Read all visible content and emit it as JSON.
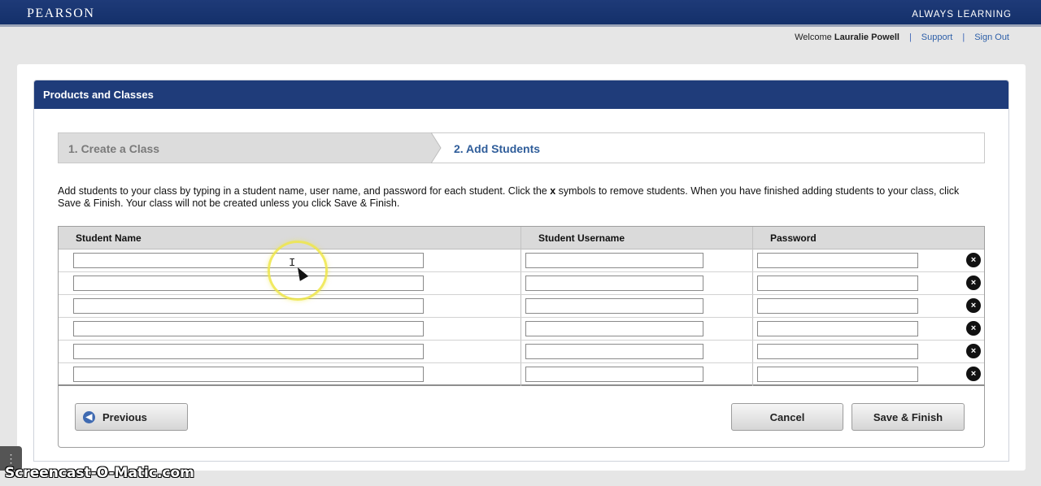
{
  "header": {
    "brand": "PEARSON",
    "tagline": "ALWAYS LEARNING"
  },
  "user": {
    "welcome": "Welcome",
    "name": "Lauralie Powell",
    "support": "Support",
    "sign_out": "Sign Out",
    "separator": "|"
  },
  "panel": {
    "title": "Products and Classes"
  },
  "steps": {
    "step1": "1. Create a Class",
    "step2": "2. Add Students",
    "active_step": 2
  },
  "intro": {
    "part1": "Add students to your class by typing in a student name, user name, and password for each student. Click the ",
    "x_symbol": "x",
    "part2": " symbols to remove students. When you have finished adding students to your class, click Save & Finish. Your class will not be created unless you click Save & Finish."
  },
  "table": {
    "columns": [
      "Student Name",
      "Student Username",
      "Password"
    ],
    "rows": [
      {
        "name": "",
        "username": "",
        "password": ""
      },
      {
        "name": "",
        "username": "",
        "password": ""
      },
      {
        "name": "",
        "username": "",
        "password": ""
      },
      {
        "name": "",
        "username": "",
        "password": ""
      },
      {
        "name": "",
        "username": "",
        "password": ""
      },
      {
        "name": "",
        "username": "",
        "password": ""
      }
    ],
    "remove_glyph": "×"
  },
  "buttons": {
    "previous": "Previous",
    "cancel": "Cancel",
    "save": "Save & Finish"
  },
  "watermark": "Screencast-O-Matic.com",
  "colors": {
    "header_bg": "#1f3c7a",
    "link": "#2d5fa8",
    "step_active": "#2f5d9a"
  },
  "icons": {
    "previous": "arrow-left-circle-icon",
    "remove": "close-circle-icon"
  }
}
